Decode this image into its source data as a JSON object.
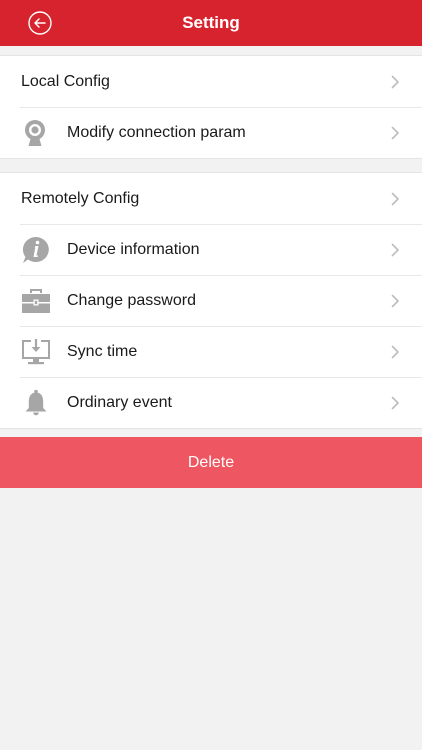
{
  "header": {
    "title": "Setting",
    "back_icon": "back-arrow-circle-icon"
  },
  "local_config": {
    "title": "Local Config",
    "items": [
      {
        "label": "Modify connection param",
        "icon": "webcam-icon"
      }
    ]
  },
  "remote_config": {
    "title": "Remotely Config",
    "items": [
      {
        "label": "Device information",
        "icon": "info-bubble-icon"
      },
      {
        "label": "Change password",
        "icon": "toolbox-icon"
      },
      {
        "label": "Sync time",
        "icon": "monitor-download-icon"
      },
      {
        "label": "Ordinary event",
        "icon": "bell-icon"
      }
    ]
  },
  "delete_button": {
    "label": "Delete"
  },
  "colors": {
    "header_bg": "#d6232e",
    "delete_bg": "#ee5661",
    "icon_gray": "#a6a6a6",
    "chevron_gray": "#bdbdbd",
    "page_bg": "#f2f2f2"
  }
}
